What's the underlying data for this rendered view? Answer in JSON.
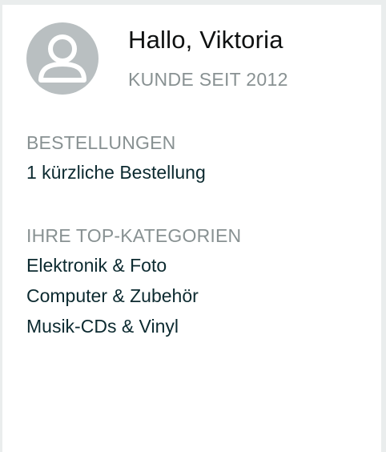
{
  "profile": {
    "greeting": "Hallo, Viktoria",
    "customer_since": "KUNDE SEIT 2012",
    "avatar_icon": "user-avatar-icon"
  },
  "orders": {
    "label": "BESTELLUNGEN",
    "recent": "1 kürzliche Bestellung"
  },
  "top_categories": {
    "label": "IHRE TOP-KATEGORIEN",
    "items": [
      "Elektronik & Foto",
      "Computer & Zubehör",
      "Musik-CDs & Vinyl"
    ]
  },
  "colors": {
    "background": "#eaeded",
    "card": "#ffffff",
    "avatar": "#b9bfc1",
    "text_primary": "#0f1111",
    "text_muted": "#889192",
    "link": "#0c2a30"
  }
}
